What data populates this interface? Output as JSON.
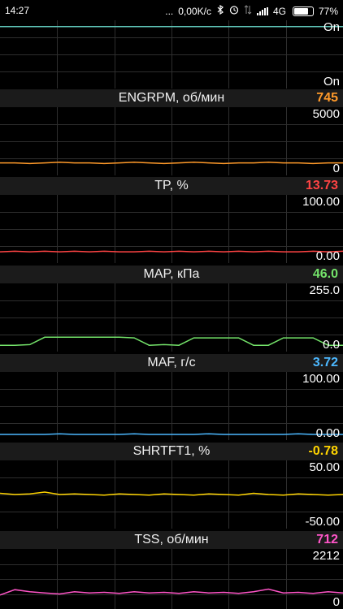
{
  "status": {
    "time": "14:27",
    "dots": "...",
    "net_speed": "0,00K/c",
    "network": "4G",
    "battery": "77%",
    "battery_level": 0.77
  },
  "panels": [
    {
      "label": "",
      "value": "",
      "color": "#5fc5b8",
      "top": "On",
      "bottom": "On",
      "series": [
        0.95,
        0.95,
        0.95,
        0.95,
        0.95,
        0.95,
        0.95,
        0.95,
        0.95,
        0.95,
        0.95,
        0.95
      ]
    },
    {
      "label": "ENGRPM, об/мин",
      "value": "745",
      "color": "#ff9a2a",
      "top": "5000",
      "bottom": "0",
      "series": [
        0.15,
        0.15,
        0.14,
        0.15,
        0.16,
        0.15,
        0.15,
        0.14,
        0.15,
        0.16,
        0.15,
        0.14,
        0.15,
        0.16,
        0.15,
        0.14,
        0.15,
        0.15,
        0.16,
        0.15,
        0.15,
        0.14,
        0.15,
        0.15
      ]
    },
    {
      "label": "TP, %",
      "value": "13.73",
      "color": "#ff4444",
      "top": "100.00",
      "bottom": "0.00",
      "series": [
        0.13,
        0.14,
        0.13,
        0.14,
        0.13,
        0.14,
        0.13,
        0.14,
        0.13,
        0.13,
        0.14,
        0.13,
        0.14,
        0.13,
        0.14,
        0.13,
        0.14,
        0.13,
        0.14,
        0.13,
        0.13,
        0.14,
        0.13,
        0.14
      ]
    },
    {
      "label": "MAP, кПа",
      "value": "46.0",
      "color": "#74e36a",
      "top": "255.0",
      "bottom": "0.0",
      "series": [
        0.05,
        0.05,
        0.06,
        0.18,
        0.18,
        0.18,
        0.18,
        0.18,
        0.18,
        0.17,
        0.05,
        0.06,
        0.05,
        0.17,
        0.17,
        0.17,
        0.17,
        0.05,
        0.05,
        0.17,
        0.17,
        0.17,
        0.05,
        0.05
      ]
    },
    {
      "label": "MAF, г/с",
      "value": "3.72",
      "color": "#4cb8ff",
      "top": "100.00",
      "bottom": "0.00",
      "series": [
        0.04,
        0.04,
        0.04,
        0.04,
        0.05,
        0.04,
        0.04,
        0.04,
        0.04,
        0.05,
        0.04,
        0.04,
        0.04,
        0.04,
        0.05,
        0.04,
        0.04,
        0.04,
        0.04,
        0.04,
        0.05,
        0.04,
        0.04,
        0.04
      ]
    },
    {
      "label": "SHRTFT1, %",
      "value": "-0.78",
      "color": "#ffd400",
      "top": "50.00",
      "bottom": "-50.00",
      "series": [
        0.52,
        0.5,
        0.51,
        0.54,
        0.5,
        0.51,
        0.5,
        0.49,
        0.51,
        0.5,
        0.49,
        0.51,
        0.5,
        0.49,
        0.51,
        0.5,
        0.49,
        0.52,
        0.5,
        0.49,
        0.51,
        0.5,
        0.49,
        0.5
      ]
    },
    {
      "label": "TSS, об/мин",
      "value": "712",
      "color": "#ff55c8",
      "top": "2212",
      "bottom": "0",
      "series": [
        0.2,
        0.3,
        0.26,
        0.24,
        0.22,
        0.26,
        0.24,
        0.25,
        0.23,
        0.26,
        0.24,
        0.25,
        0.23,
        0.26,
        0.24,
        0.25,
        0.23,
        0.26,
        0.31,
        0.24,
        0.25,
        0.23,
        0.26,
        0.24
      ]
    }
  ]
}
